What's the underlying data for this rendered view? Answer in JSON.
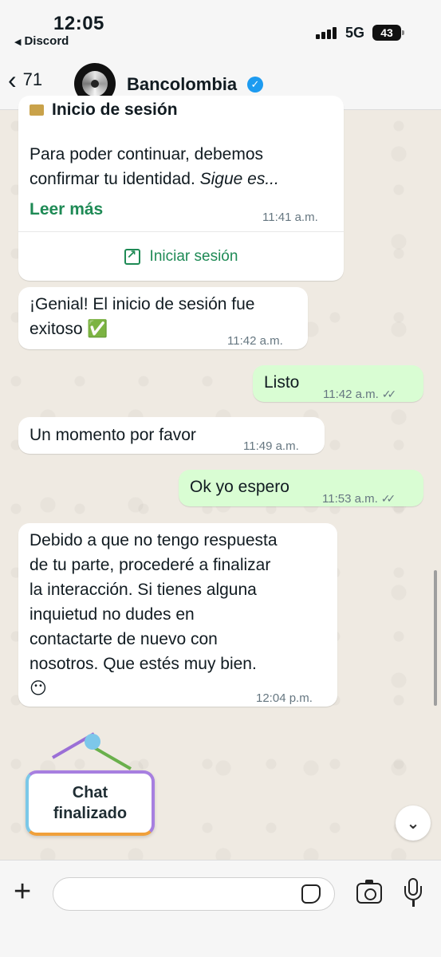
{
  "status_bar": {
    "time": "12:05",
    "back_app": "Discord",
    "network": "5G",
    "battery": "43"
  },
  "header": {
    "back_count": "71",
    "contact_name": "Bancolombia",
    "verified_icon": "verified-check-icon"
  },
  "card": {
    "title": "Inicio de sesión",
    "body_line1": "Para poder continuar, debemos",
    "body_line2a": "confirmar tu identidad. ",
    "body_line2b": "Sigue es...",
    "read_more": "Leer más",
    "time": "11:41 a.m.",
    "action_label": "Iniciar sesión",
    "action_icon": "external-link-icon"
  },
  "messages": [
    {
      "direction": "in",
      "text_line1": "¡Genial! El inicio de sesión fue",
      "text_line2": "exitoso ✅",
      "time": "11:42 a.m."
    },
    {
      "direction": "out",
      "text": "Listo",
      "time": "11:42 a.m.",
      "ticks": "✓✓"
    },
    {
      "direction": "in",
      "text": "Un momento por favor",
      "time": "11:49 a.m."
    },
    {
      "direction": "out",
      "text": "Ok yo espero",
      "time": "11:53 a.m.",
      "ticks": "✓✓"
    },
    {
      "direction": "in",
      "lines": [
        "Debido a que no tengo respuesta",
        "de tu parte, procederé a finalizar",
        "la interacción. Si tienes alguna",
        "inquietud no dudes en",
        "contactarte de nuevo con",
        "nosotros. Que estés muy bien.",
        "😶"
      ],
      "time": "12:04 p.m."
    }
  ],
  "sign": {
    "line1": "Chat",
    "line2": "finalizado"
  },
  "input_bar": {
    "placeholder": ""
  },
  "colors": {
    "outgoing_bubble": "#d9fdd3",
    "incoming_bubble": "#ffffff",
    "link_green": "#1e8a55",
    "chat_background": "#efeae2"
  }
}
